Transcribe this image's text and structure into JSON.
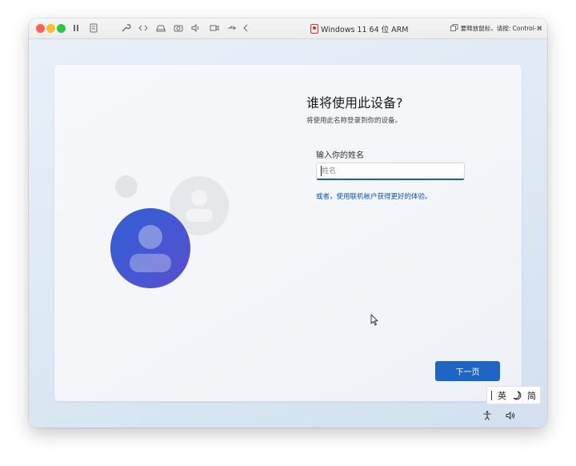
{
  "window": {
    "title": "Windows 11 64 位 ARM",
    "release_hint": "要释放鼠标，请按: Control-⌘"
  },
  "toolbar_icons": [
    "pause-icon",
    "snapshot-icon",
    "wrench-icon",
    "code-icon",
    "drive-icon",
    "camera-icon",
    "speaker-icon",
    "display-icon",
    "usb-icon",
    "chevron-left-icon"
  ],
  "setup": {
    "question": "谁将使用此设备?",
    "subtitle": "将使用此名称登录到你的设备。",
    "name_label": "输入你的姓名",
    "name_placeholder": "姓名",
    "name_value": "",
    "ms_account_link": "或者，使用联机帐户获得更好的体验。",
    "next_button": "下一页"
  },
  "ime": {
    "language": "英",
    "charset": "简"
  },
  "colors": {
    "accent": "#1f66c4",
    "link": "#0a56b5",
    "avatar_blue": "#2f5fd4",
    "avatar_purple": "#5a4fcf"
  }
}
